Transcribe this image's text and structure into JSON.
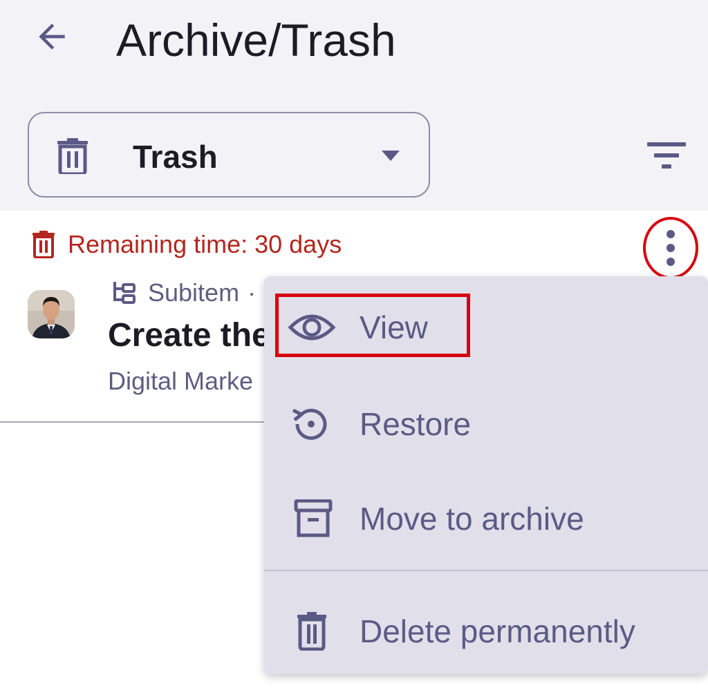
{
  "header": {
    "title": "Archive/Trash",
    "back_icon": "arrow-back-icon"
  },
  "filter_dropdown": {
    "selected": "Trash",
    "icon": "trash-icon"
  },
  "filter_button": {
    "icon": "filter-icon"
  },
  "item": {
    "remaining_time": "Remaining time: 30 days",
    "type_label": "Subitem",
    "type_separator": "·",
    "title": "Create the",
    "board": "Digital Marke"
  },
  "context_menu": {
    "items": [
      {
        "label": "View",
        "icon": "eye-icon"
      },
      {
        "label": "Restore",
        "icon": "restore-icon"
      },
      {
        "label": "Move to archive",
        "icon": "archive-icon"
      },
      {
        "label": "Delete permanently",
        "icon": "trash-icon"
      }
    ]
  },
  "colors": {
    "accent": "#5b5a86",
    "danger": "#b3261e",
    "highlight": "#d7000f",
    "menu_bg": "#e1e0ea",
    "topbar_bg": "#f3f3f7"
  }
}
